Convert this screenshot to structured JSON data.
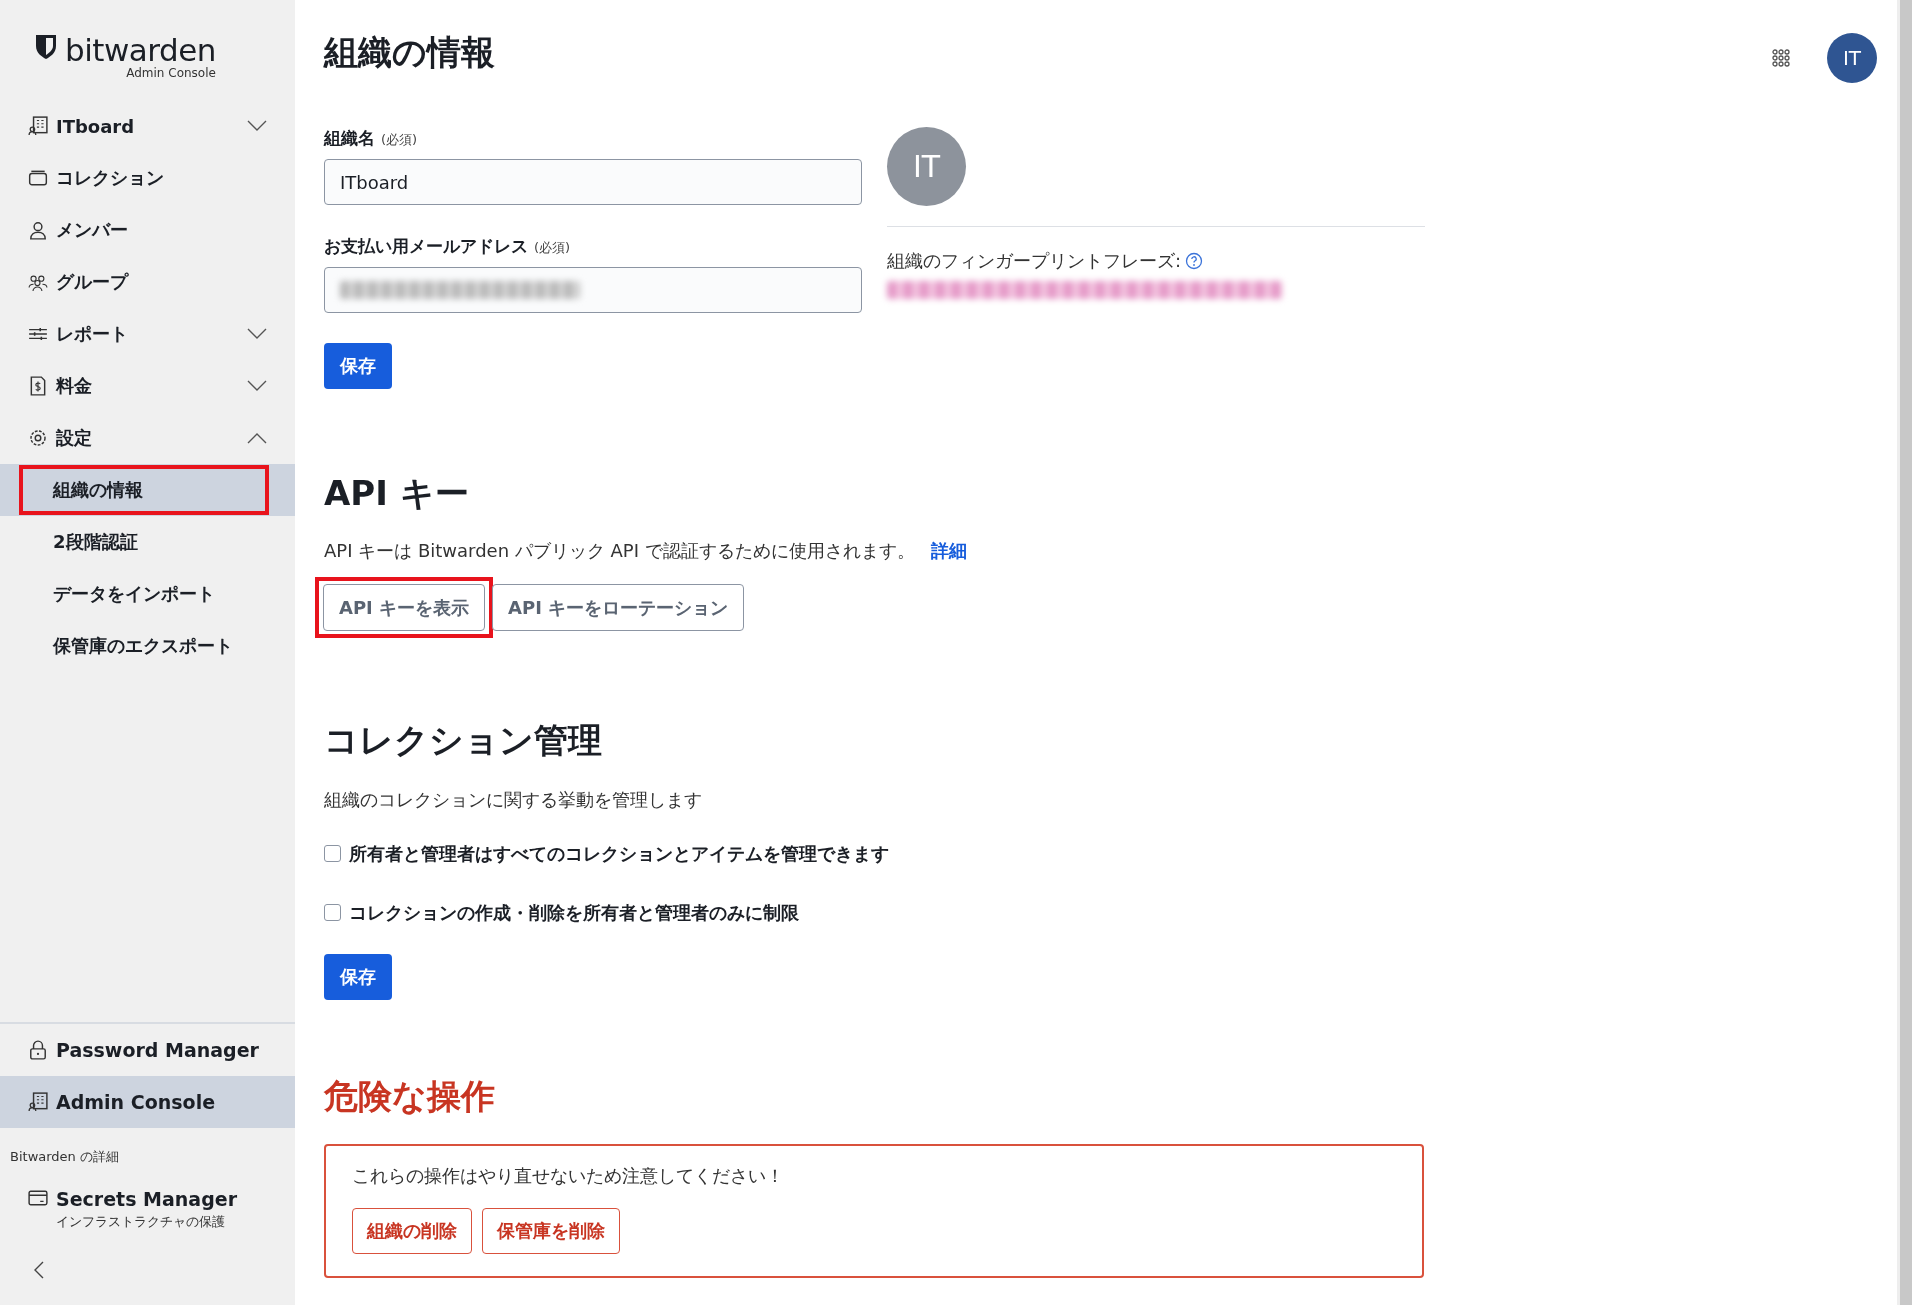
{
  "sidebar": {
    "logo": {
      "name": "bitwarden",
      "subtitle": "Admin Console"
    },
    "items": [
      {
        "label": "ITboard",
        "kind": "org",
        "expanded": false
      },
      {
        "label": "コレクション",
        "kind": "collection"
      },
      {
        "label": "メンバー",
        "kind": "person"
      },
      {
        "label": "グループ",
        "kind": "group"
      },
      {
        "label": "レポート",
        "kind": "sliders",
        "expanded": false
      },
      {
        "label": "料金",
        "kind": "bill",
        "expanded": false
      },
      {
        "label": "設定",
        "kind": "gear",
        "expanded": true,
        "children": [
          {
            "label": "組織の情報",
            "selected": true,
            "highlighted": true
          },
          {
            "label": "2段階認証",
            "selected": false,
            "highlighted": false
          },
          {
            "label": "データをインポート",
            "selected": false,
            "highlighted": false
          },
          {
            "label": "保管庫のエクスポート",
            "selected": false,
            "highlighted": false
          }
        ]
      }
    ],
    "products": [
      {
        "label": "Password Manager",
        "kind": "lock",
        "selected": false
      },
      {
        "label": "Admin Console",
        "kind": "org",
        "selected": true
      }
    ],
    "more_title": "Bitwarden の詳細",
    "more": [
      {
        "label": "Secrets Manager",
        "sub": "インフラストラクチャの保護",
        "kind": "card"
      }
    ]
  },
  "header": {
    "title": "組織の情報",
    "avatar": "IT"
  },
  "org_form": {
    "name_label": "組織名",
    "name_required": "(必須)",
    "name_value": "ITboard",
    "email_label": "お支払い用メールアドレス",
    "email_required": "(必須)",
    "email_redacted": true,
    "save": "保存",
    "org_avatar": "IT",
    "fingerprint_label": "組織のフィンガープリントフレーズ:",
    "fingerprint_redacted": true
  },
  "api": {
    "title": "API キー",
    "description": "API キーは Bitwarden パブリック API で認証するために使用されます。",
    "link": "詳細",
    "buttons": [
      {
        "label": "API キーを表示",
        "highlighted": true
      },
      {
        "label": "API キーをローテーション",
        "highlighted": false
      }
    ]
  },
  "collections": {
    "title": "コレクション管理",
    "description": "組織のコレクションに関する挙動を管理します",
    "options": [
      {
        "label": "所有者と管理者はすべてのコレクションとアイテムを管理できます",
        "checked": false
      },
      {
        "label": "コレクションの作成・削除を所有者と管理者のみに制限",
        "checked": false
      }
    ],
    "save": "保存"
  },
  "danger": {
    "title": "危険な操作",
    "warning": "これらの操作はやり直せないため注意してください！",
    "buttons": [
      "組織の削除",
      "保管庫を削除"
    ]
  }
}
